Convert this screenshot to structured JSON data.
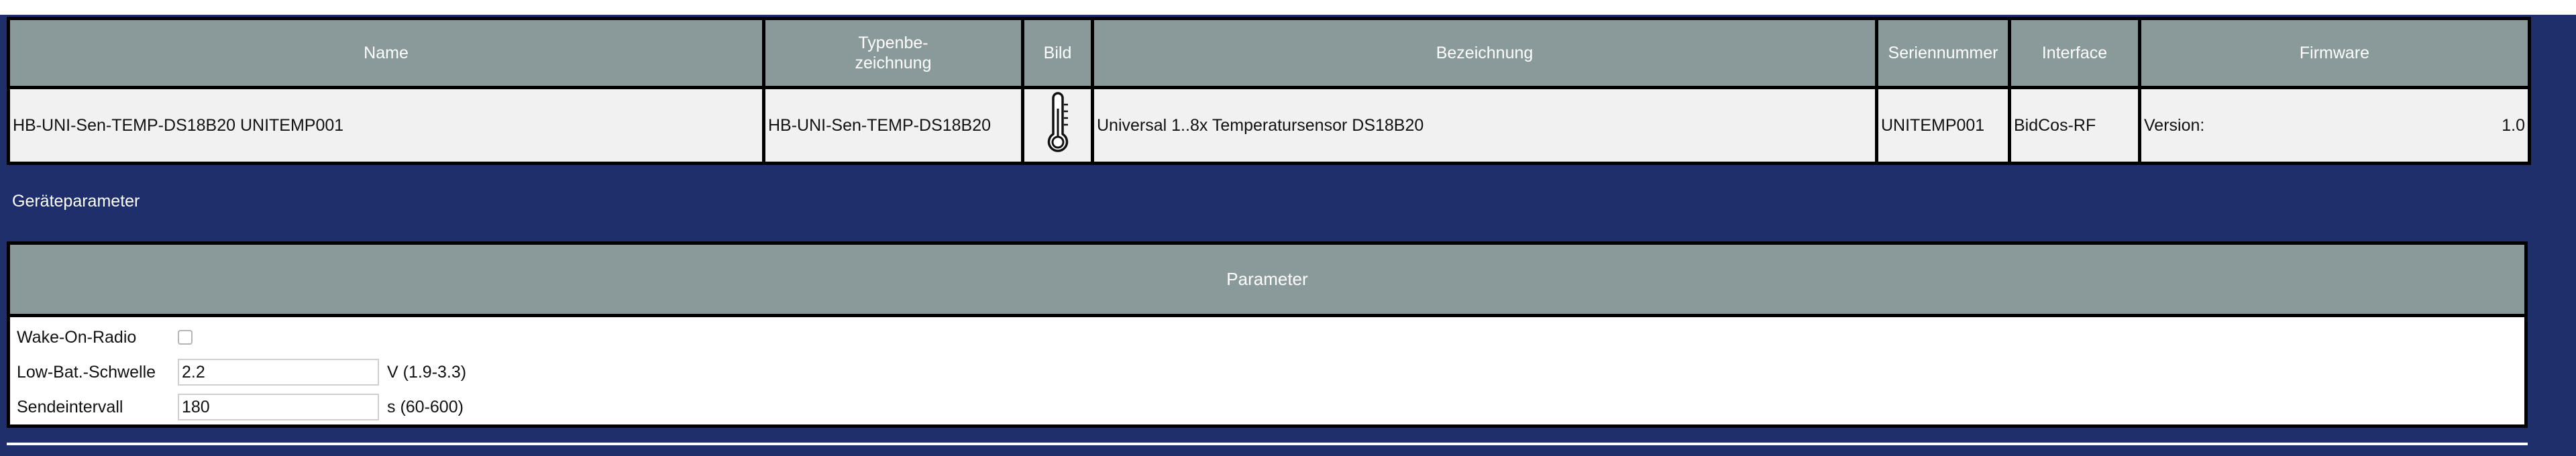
{
  "device_table": {
    "headers": {
      "name": "Name",
      "type_line1": "Typenbe-",
      "type_line2": "zeichnung",
      "image": "Bild",
      "description": "Bezeichnung",
      "serial": "Seriennummer",
      "interface": "Interface",
      "firmware": "Firmware"
    },
    "row": {
      "name": "HB-UNI-Sen-TEMP-DS18B20 UNITEMP001",
      "type": "HB-UNI-Sen-TEMP-DS18B20",
      "image_icon": "thermometer-icon",
      "description": "Universal 1..8x Temperatursensor DS18B20",
      "serial": "UNITEMP001",
      "interface": "BidCos-RF",
      "firmware_label": "Version:",
      "firmware_value": "1.0"
    }
  },
  "section_label": "Geräteparameter",
  "parameters": {
    "header": "Parameter",
    "rows": [
      {
        "label": "Wake-On-Radio",
        "control": "checkbox",
        "checked": false
      },
      {
        "label": "Low-Bat.-Schwelle",
        "control": "text",
        "value": "2.2",
        "unit": "V (1.9-3.3)"
      },
      {
        "label": "Sendeintervall",
        "control": "text",
        "value": "180",
        "unit": "s (60-600)"
      }
    ]
  }
}
